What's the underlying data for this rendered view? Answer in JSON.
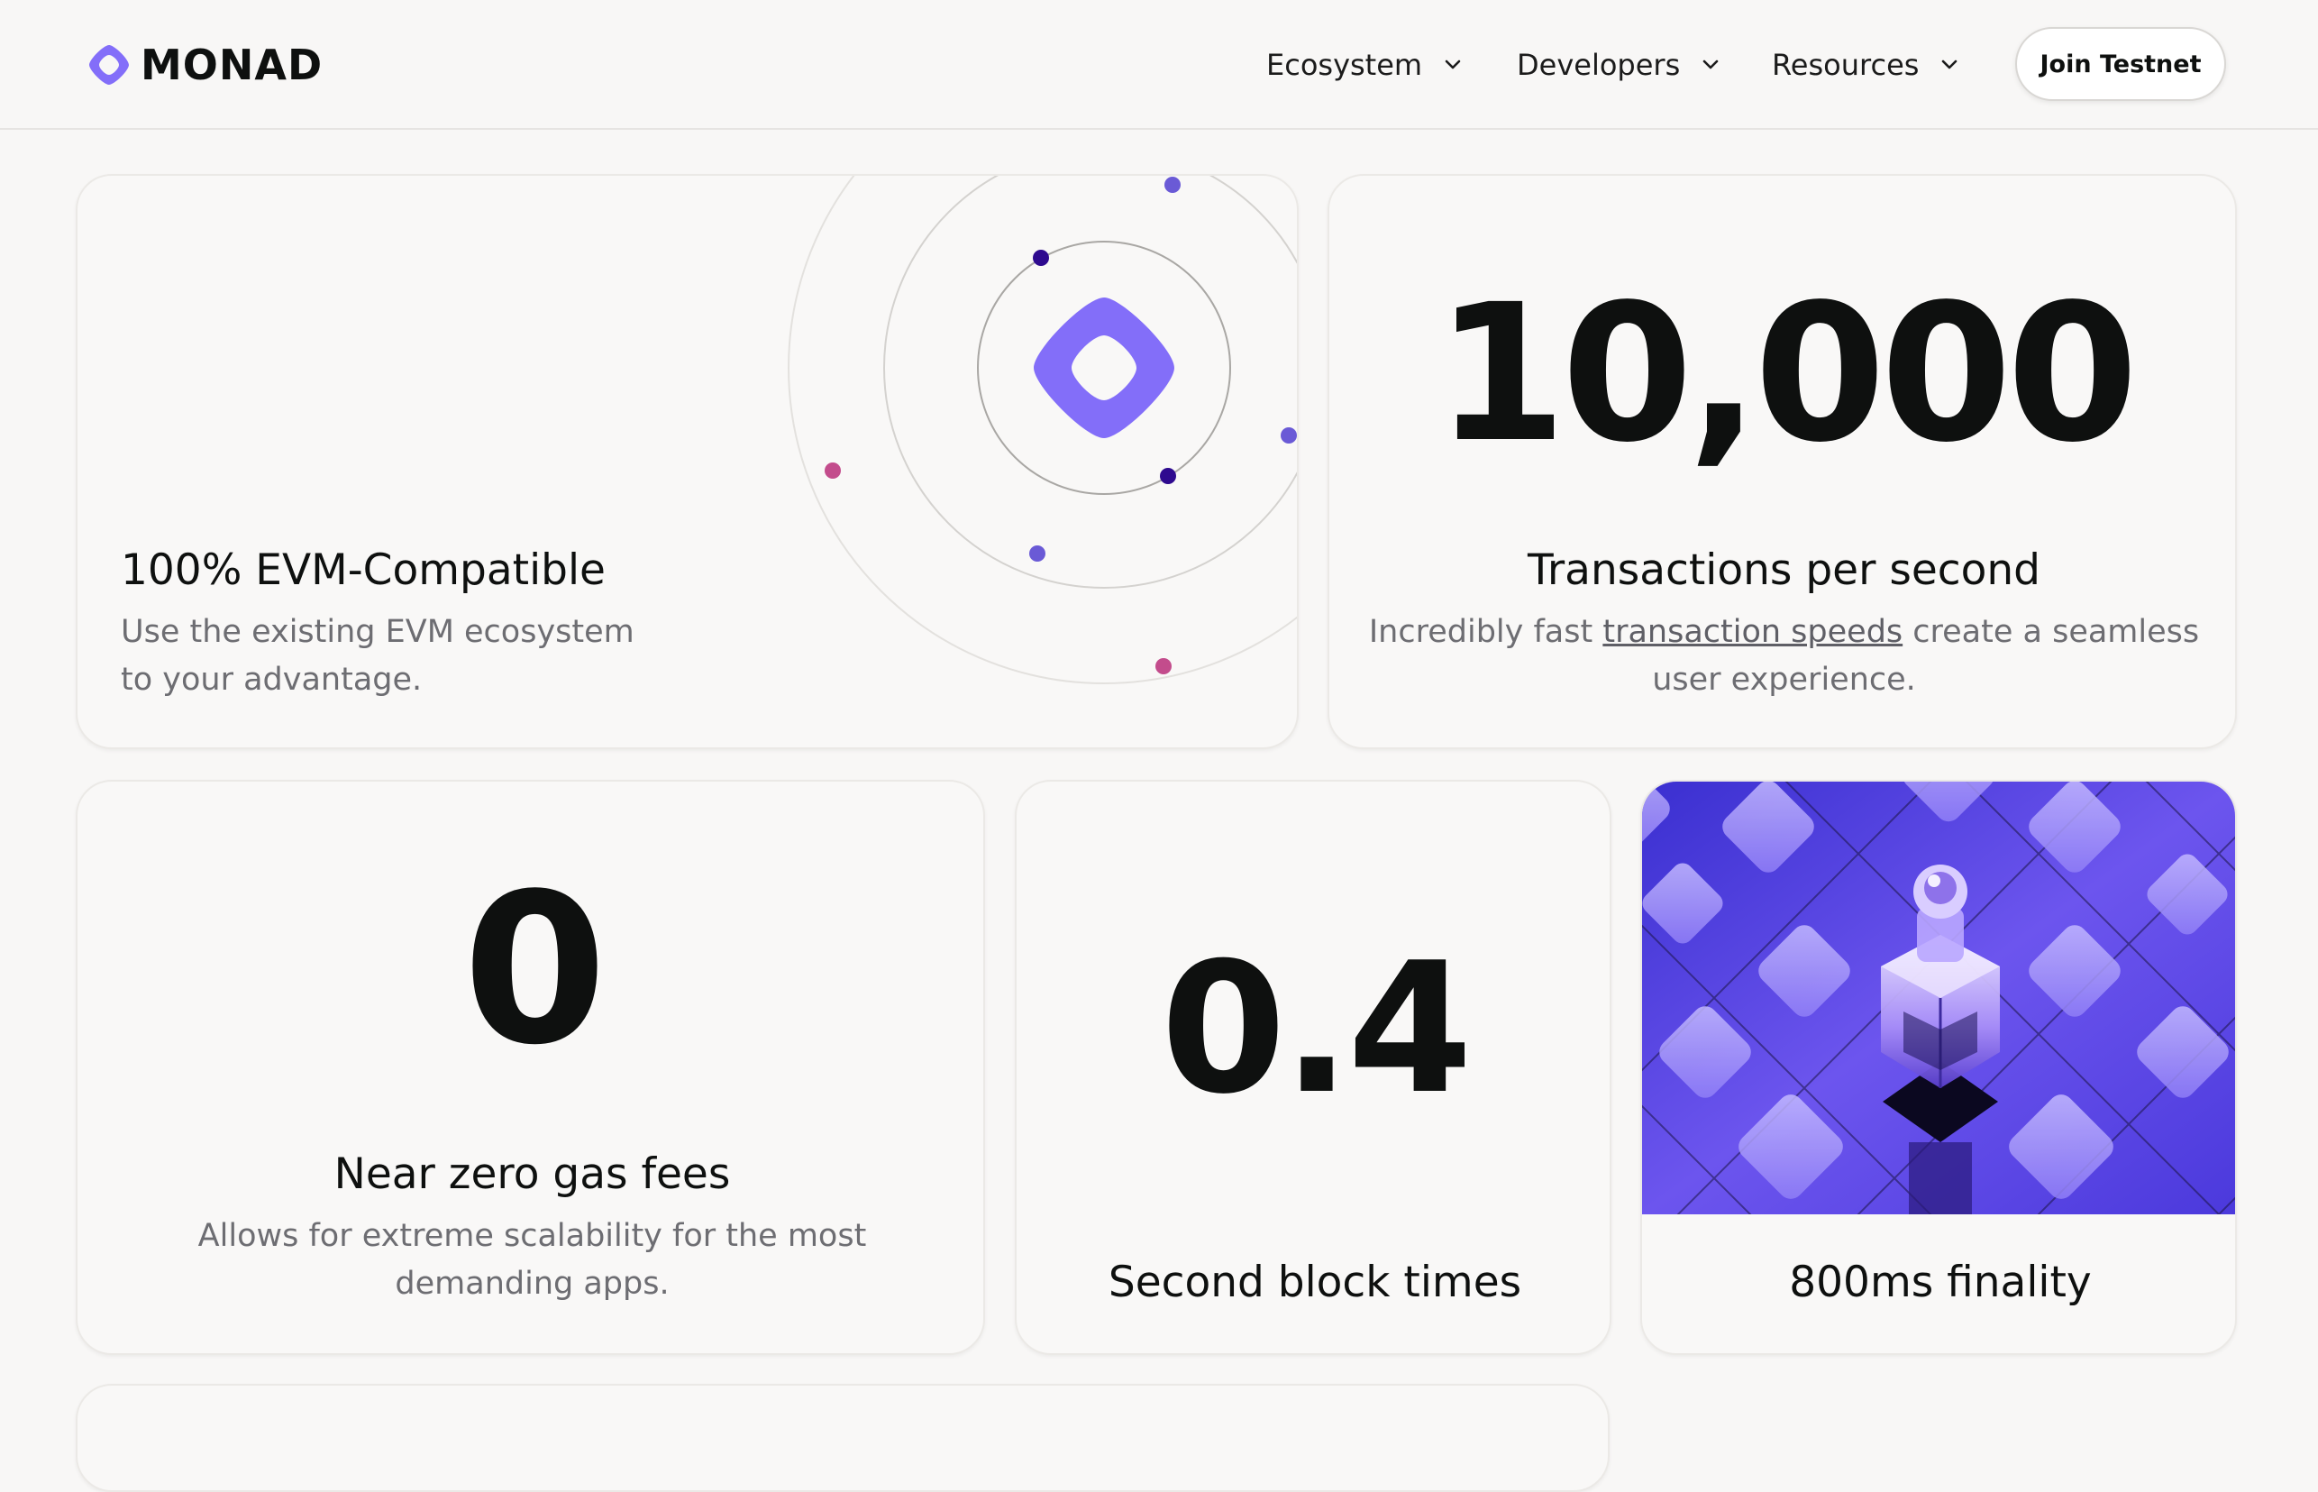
{
  "header": {
    "brand": "MONAD",
    "nav": [
      {
        "label": "Ecosystem"
      },
      {
        "label": "Developers"
      },
      {
        "label": "Resources"
      }
    ],
    "cta": "Join Testnet"
  },
  "colors": {
    "accent": "#836ef9",
    "dark_purple": "#2e0a8f",
    "pink": "#c34c8c",
    "text": "#0e100f",
    "muted": "#6d6d72"
  },
  "cards": {
    "evm": {
      "title": "100% EVM-Compatible",
      "desc_line1": "Use the existing EVM ecosystem",
      "desc_line2": "to your advantage."
    },
    "tps": {
      "value": "10,000",
      "title": "Transactions per second",
      "desc_before": "Incredibly fast ",
      "desc_link": "transaction speeds",
      "desc_after": " create a seamless",
      "desc_line2": "user experience."
    },
    "gas": {
      "value": "0",
      "title": "Near zero gas fees",
      "desc_line1": "Allows for extreme scalability for the most",
      "desc_line2": "demanding apps."
    },
    "block": {
      "value": "0.4",
      "title": "Second block times"
    },
    "finality": {
      "title": "800ms finality"
    }
  }
}
